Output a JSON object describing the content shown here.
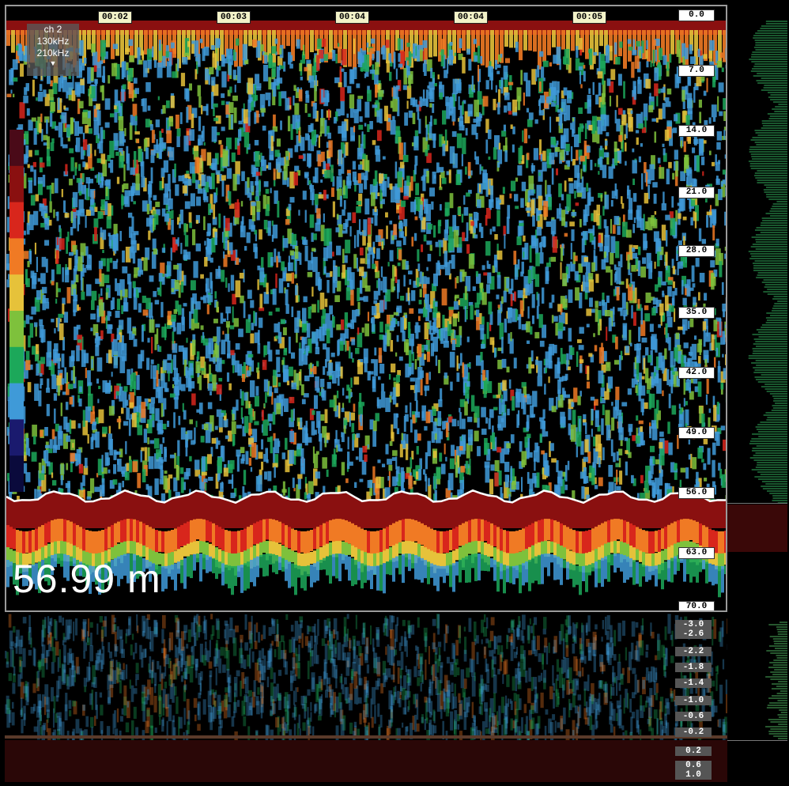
{
  "colors": {
    "background": "#000000",
    "bottom_echo": "#6e1010",
    "bottom_line": "#ffffff",
    "label_bg": "#ffffff",
    "time_label_bg": "#f2f2c8",
    "panel_gray": "#5a5a5a"
  },
  "color_scale": [
    "#0a0a3c",
    "#1a1a6e",
    "#3f9ad8",
    "#1ca85a",
    "#7ec13c",
    "#e6c23a",
    "#f07a24",
    "#d8261c",
    "#8a1010",
    "#4a0a18"
  ],
  "channel": {
    "name": "ch 2",
    "freq_low": "130kHz",
    "freq_high": "210kHz",
    "caret": "▼"
  },
  "depth_readout": "56.99 m",
  "time_ticks": [
    "00:02",
    "00:03",
    "00:04",
    "00:04",
    "00:05"
  ],
  "depth_scale": [
    "0.0",
    "7.0",
    "14.0",
    "21.0",
    "28.0",
    "35.0",
    "42.0",
    "49.0",
    "56.0",
    "63.0",
    "70.0"
  ],
  "bottom_offset_scale": [
    "-3.0",
    "-2.6",
    "-2.2",
    "-1.8",
    "-1.4",
    "-1.0",
    "-0.6",
    "-0.2",
    "0.2",
    "0.6",
    "1.0"
  ]
}
